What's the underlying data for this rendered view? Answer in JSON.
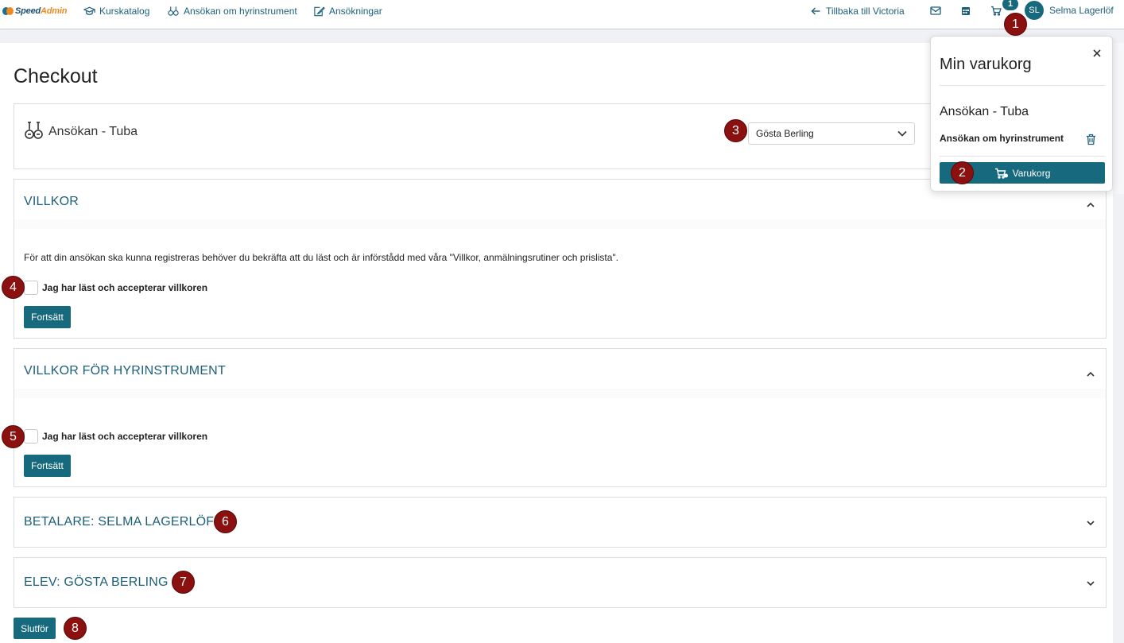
{
  "brand": {
    "speed": "Speed",
    "admin": "Admin"
  },
  "nav": {
    "links": [
      {
        "label": "Kurskatalog",
        "icon": "graduation-cap-icon"
      },
      {
        "label": "Ansökan om hyrinstrument",
        "icon": "guitars-icon"
      },
      {
        "label": "Ansökningar",
        "icon": "edit-document-icon"
      }
    ],
    "back_label": "Tillbaka till Victoria",
    "cart_count": "1",
    "avatar_initials": "SL",
    "user_name": "Selma Lagerlöf"
  },
  "page": {
    "title": "Checkout"
  },
  "product": {
    "title": "Ansökan - Tuba",
    "student_select": "Gösta Berling"
  },
  "sections": {
    "villkor": {
      "title": "VILLKOR",
      "text": "För att din ansökan ska kunna registreras behöver du bekräfta att du läst och är införstådd med våra \"Villkor, anmälningsrutiner och prislista\".",
      "checkbox_label": "Jag har läst och accepterar villkoren",
      "button": "Fortsätt"
    },
    "hyr": {
      "title": "VILLKOR FÖR HYRINSTRUMENT",
      "checkbox_label": "Jag har läst och accepterar villkoren",
      "button": "Fortsätt"
    },
    "betalare": {
      "title": "BETALARE: SELMA LAGERLÖF"
    },
    "elev": {
      "title": "ELEV: GÖSTA BERLING"
    }
  },
  "finish_button": "Slutför",
  "cart": {
    "title": "Min varukorg",
    "item_title": "Ansökan - Tuba",
    "item_sub": "Ansökan om hyrinstrument",
    "button": "Varukorg"
  },
  "markers": [
    "1",
    "2",
    "3",
    "4",
    "5",
    "6",
    "7",
    "8"
  ],
  "colors": {
    "accent": "#176a7d",
    "link": "#1c5f7a",
    "marker": "#8b1010"
  }
}
